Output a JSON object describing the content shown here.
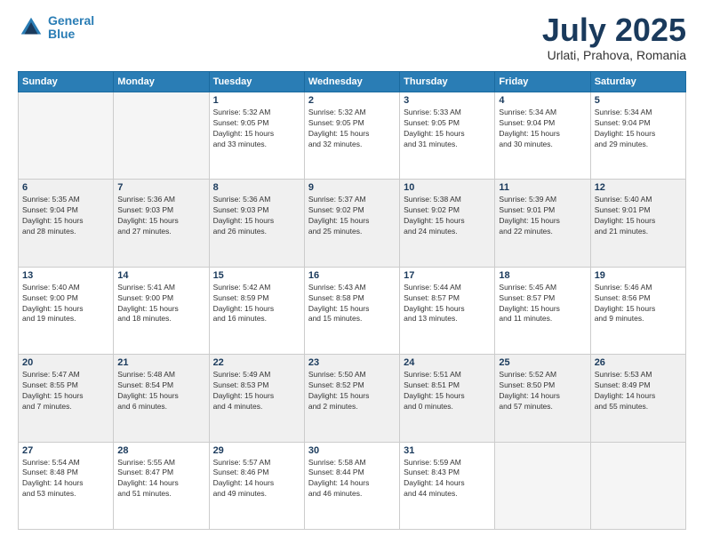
{
  "logo": {
    "line1": "General",
    "line2": "Blue"
  },
  "title": "July 2025",
  "subtitle": "Urlati, Prahova, Romania",
  "weekdays": [
    "Sunday",
    "Monday",
    "Tuesday",
    "Wednesday",
    "Thursday",
    "Friday",
    "Saturday"
  ],
  "weeks": [
    [
      {
        "day": "",
        "info": ""
      },
      {
        "day": "",
        "info": ""
      },
      {
        "day": "1",
        "info": "Sunrise: 5:32 AM\nSunset: 9:05 PM\nDaylight: 15 hours\nand 33 minutes."
      },
      {
        "day": "2",
        "info": "Sunrise: 5:32 AM\nSunset: 9:05 PM\nDaylight: 15 hours\nand 32 minutes."
      },
      {
        "day": "3",
        "info": "Sunrise: 5:33 AM\nSunset: 9:05 PM\nDaylight: 15 hours\nand 31 minutes."
      },
      {
        "day": "4",
        "info": "Sunrise: 5:34 AM\nSunset: 9:04 PM\nDaylight: 15 hours\nand 30 minutes."
      },
      {
        "day": "5",
        "info": "Sunrise: 5:34 AM\nSunset: 9:04 PM\nDaylight: 15 hours\nand 29 minutes."
      }
    ],
    [
      {
        "day": "6",
        "info": "Sunrise: 5:35 AM\nSunset: 9:04 PM\nDaylight: 15 hours\nand 28 minutes."
      },
      {
        "day": "7",
        "info": "Sunrise: 5:36 AM\nSunset: 9:03 PM\nDaylight: 15 hours\nand 27 minutes."
      },
      {
        "day": "8",
        "info": "Sunrise: 5:36 AM\nSunset: 9:03 PM\nDaylight: 15 hours\nand 26 minutes."
      },
      {
        "day": "9",
        "info": "Sunrise: 5:37 AM\nSunset: 9:02 PM\nDaylight: 15 hours\nand 25 minutes."
      },
      {
        "day": "10",
        "info": "Sunrise: 5:38 AM\nSunset: 9:02 PM\nDaylight: 15 hours\nand 24 minutes."
      },
      {
        "day": "11",
        "info": "Sunrise: 5:39 AM\nSunset: 9:01 PM\nDaylight: 15 hours\nand 22 minutes."
      },
      {
        "day": "12",
        "info": "Sunrise: 5:40 AM\nSunset: 9:01 PM\nDaylight: 15 hours\nand 21 minutes."
      }
    ],
    [
      {
        "day": "13",
        "info": "Sunrise: 5:40 AM\nSunset: 9:00 PM\nDaylight: 15 hours\nand 19 minutes."
      },
      {
        "day": "14",
        "info": "Sunrise: 5:41 AM\nSunset: 9:00 PM\nDaylight: 15 hours\nand 18 minutes."
      },
      {
        "day": "15",
        "info": "Sunrise: 5:42 AM\nSunset: 8:59 PM\nDaylight: 15 hours\nand 16 minutes."
      },
      {
        "day": "16",
        "info": "Sunrise: 5:43 AM\nSunset: 8:58 PM\nDaylight: 15 hours\nand 15 minutes."
      },
      {
        "day": "17",
        "info": "Sunrise: 5:44 AM\nSunset: 8:57 PM\nDaylight: 15 hours\nand 13 minutes."
      },
      {
        "day": "18",
        "info": "Sunrise: 5:45 AM\nSunset: 8:57 PM\nDaylight: 15 hours\nand 11 minutes."
      },
      {
        "day": "19",
        "info": "Sunrise: 5:46 AM\nSunset: 8:56 PM\nDaylight: 15 hours\nand 9 minutes."
      }
    ],
    [
      {
        "day": "20",
        "info": "Sunrise: 5:47 AM\nSunset: 8:55 PM\nDaylight: 15 hours\nand 7 minutes."
      },
      {
        "day": "21",
        "info": "Sunrise: 5:48 AM\nSunset: 8:54 PM\nDaylight: 15 hours\nand 6 minutes."
      },
      {
        "day": "22",
        "info": "Sunrise: 5:49 AM\nSunset: 8:53 PM\nDaylight: 15 hours\nand 4 minutes."
      },
      {
        "day": "23",
        "info": "Sunrise: 5:50 AM\nSunset: 8:52 PM\nDaylight: 15 hours\nand 2 minutes."
      },
      {
        "day": "24",
        "info": "Sunrise: 5:51 AM\nSunset: 8:51 PM\nDaylight: 15 hours\nand 0 minutes."
      },
      {
        "day": "25",
        "info": "Sunrise: 5:52 AM\nSunset: 8:50 PM\nDaylight: 14 hours\nand 57 minutes."
      },
      {
        "day": "26",
        "info": "Sunrise: 5:53 AM\nSunset: 8:49 PM\nDaylight: 14 hours\nand 55 minutes."
      }
    ],
    [
      {
        "day": "27",
        "info": "Sunrise: 5:54 AM\nSunset: 8:48 PM\nDaylight: 14 hours\nand 53 minutes."
      },
      {
        "day": "28",
        "info": "Sunrise: 5:55 AM\nSunset: 8:47 PM\nDaylight: 14 hours\nand 51 minutes."
      },
      {
        "day": "29",
        "info": "Sunrise: 5:57 AM\nSunset: 8:46 PM\nDaylight: 14 hours\nand 49 minutes."
      },
      {
        "day": "30",
        "info": "Sunrise: 5:58 AM\nSunset: 8:44 PM\nDaylight: 14 hours\nand 46 minutes."
      },
      {
        "day": "31",
        "info": "Sunrise: 5:59 AM\nSunset: 8:43 PM\nDaylight: 14 hours\nand 44 minutes."
      },
      {
        "day": "",
        "info": ""
      },
      {
        "day": "",
        "info": ""
      }
    ]
  ]
}
